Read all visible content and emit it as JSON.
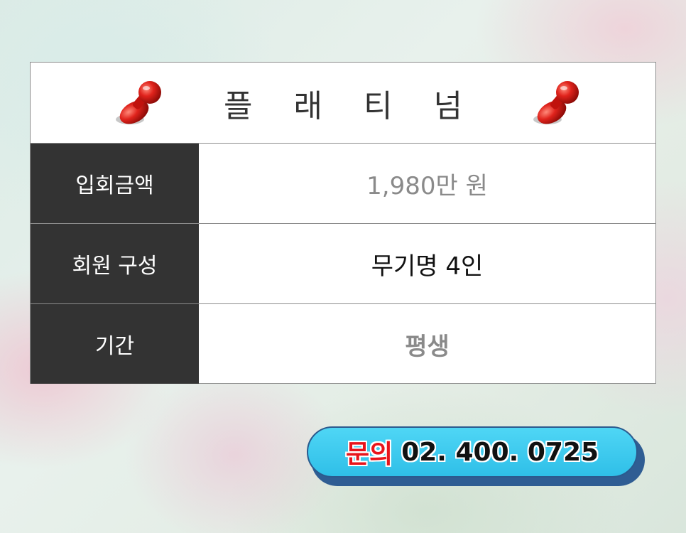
{
  "title": "플 래 티 넘",
  "rows": [
    {
      "label": "입회금액",
      "value": "1,980만 원"
    },
    {
      "label": "회원 구성",
      "value": "무기명 4인"
    },
    {
      "label": "기간",
      "value": "평생"
    }
  ],
  "contact": {
    "label": "문의",
    "number": "02. 400. 0725"
  },
  "colors": {
    "label_bg": "#333333",
    "pin_red": "#d8141b",
    "contact_bg": "#33c3ea",
    "contact_label": "#e8141b"
  },
  "icons": [
    "push-pin-icon",
    "push-pin-icon"
  ]
}
